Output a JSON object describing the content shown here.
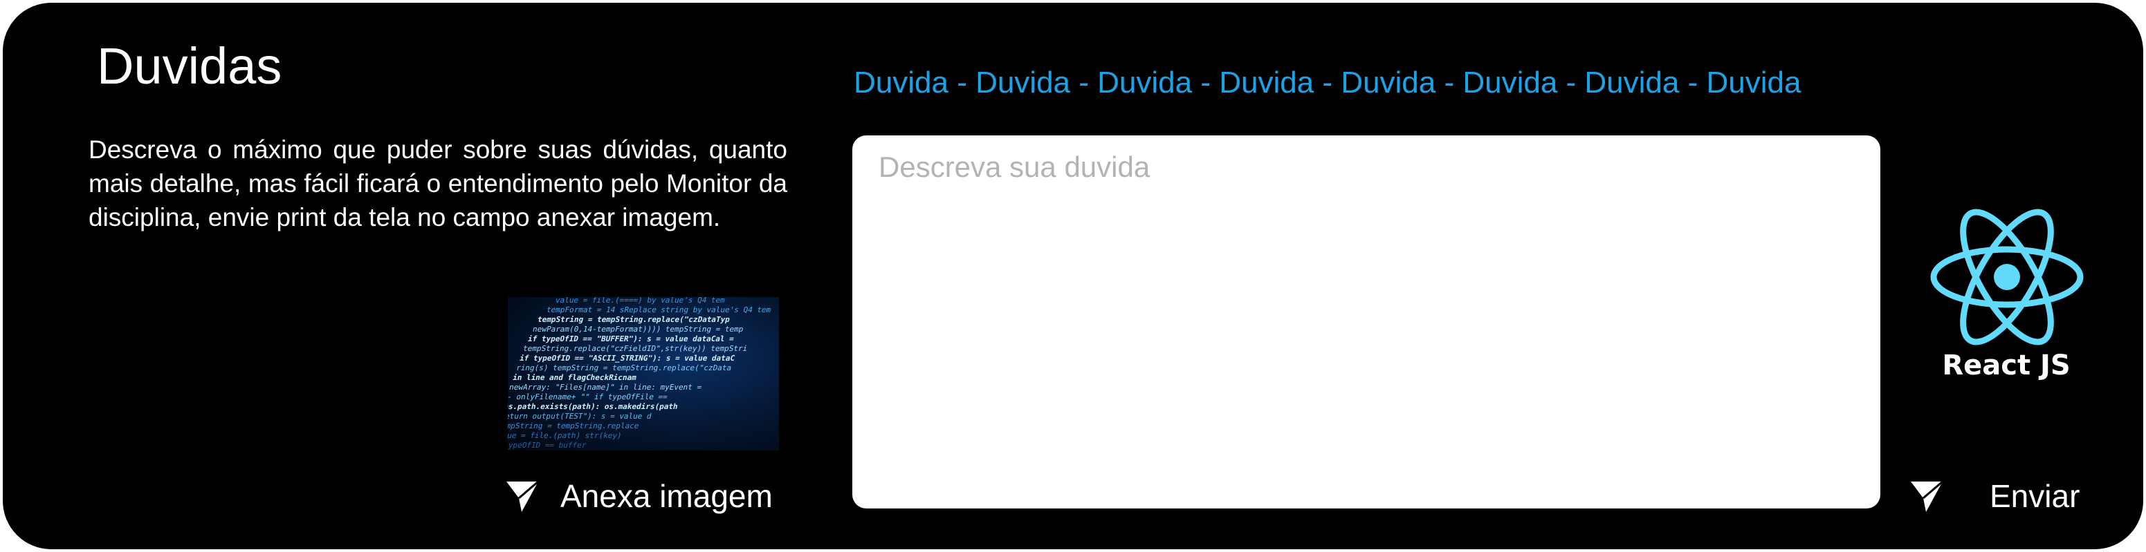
{
  "header": {
    "title": "Duvidas",
    "banner": "Duvida - Duvida - Duvida - Duvida - Duvida - Duvida - Duvida - Duvida"
  },
  "description": {
    "text": "Descreva o máximo que puder sobre suas dúvidas, quanto mais detalhe, mas fácil ficará o entendimento pelo Monitor da disciplina, envie print da tela no campo anexar imagem."
  },
  "attachment": {
    "image_icon": "code-screenshot-icon",
    "button_label": "Anexa imagem",
    "button_icon": "send-icon"
  },
  "question": {
    "placeholder": "Descreva sua duvida",
    "value": ""
  },
  "branding": {
    "logo_icon": "react-logo-icon",
    "label": "React JS",
    "logo_color": "#61dafb"
  },
  "send": {
    "button_label": "Enviar",
    "button_icon": "send-icon"
  },
  "colors": {
    "background": "#000000",
    "accent": "#1aa3e8",
    "text": "#ffffff",
    "placeholder": "#b3b3b3"
  }
}
